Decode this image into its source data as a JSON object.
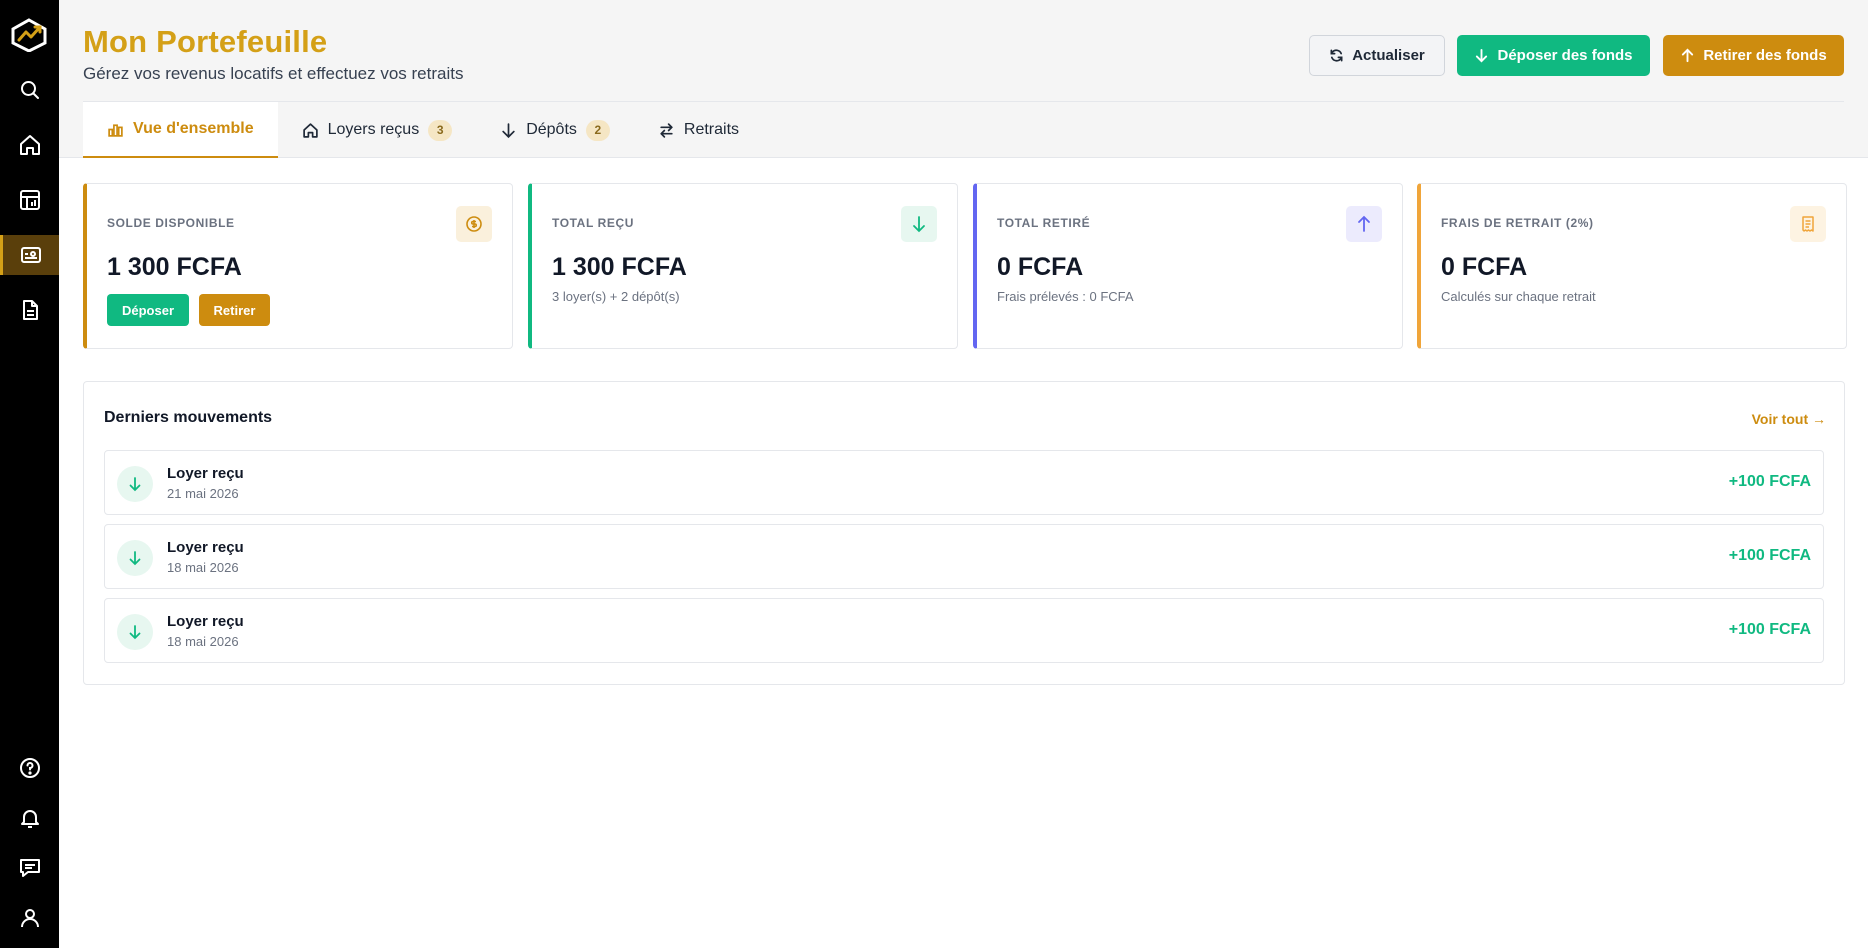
{
  "colors": {
    "gold": "#cd8c0f",
    "green": "#10b981",
    "purple": "#6366f1",
    "orange": "#f0a53a",
    "sidebar": "#000000"
  },
  "sidebar": {
    "items": [
      {
        "icon": "search-icon"
      },
      {
        "icon": "home-icon"
      },
      {
        "icon": "building-chart-icon"
      },
      {
        "icon": "wallet-icon",
        "active": true
      },
      {
        "icon": "document-icon"
      },
      {
        "icon": "help-icon"
      },
      {
        "icon": "bell-icon"
      },
      {
        "icon": "chat-icon"
      },
      {
        "icon": "user-icon"
      }
    ]
  },
  "header": {
    "title": "Mon Portefeuille",
    "subtitle": "Gérez vos revenus locatifs et effectuez vos retraits",
    "refresh_label": "Actualiser",
    "deposit_label": "Déposer des fonds",
    "withdraw_label": "Retirer des fonds"
  },
  "tabs": [
    {
      "label": "Vue d'ensemble",
      "active": true
    },
    {
      "label": "Loyers reçus",
      "count": "3"
    },
    {
      "label": "Dépôts",
      "count": "2"
    },
    {
      "label": "Retraits"
    }
  ],
  "stats": [
    {
      "label": "SOLDE DISPONIBLE",
      "value": "1 300 FCFA",
      "deposit_btn": "Déposer",
      "withdraw_btn": "Retirer"
    },
    {
      "label": "TOTAL REÇU",
      "value": "1 300 FCFA",
      "note": "3 loyer(s) + 2 dépôt(s)"
    },
    {
      "label": "TOTAL RETIRÉ",
      "value": "0 FCFA",
      "note": "Frais prélevés : 0 FCFA"
    },
    {
      "label": "FRAIS DE RETRAIT (2%)",
      "value": "0 FCFA",
      "note": "Calculés sur chaque retrait"
    }
  ],
  "movements": {
    "title": "Derniers mouvements",
    "link": "Voir tout →",
    "items": [
      {
        "name": "Loyer reçu",
        "date": "21 mai 2026",
        "amount": "+100 FCFA"
      },
      {
        "name": "Loyer reçu",
        "date": "18 mai 2026",
        "amount": "+100 FCFA"
      },
      {
        "name": "Loyer reçu",
        "date": "18 mai 2026",
        "amount": "+100 FCFA"
      }
    ]
  }
}
